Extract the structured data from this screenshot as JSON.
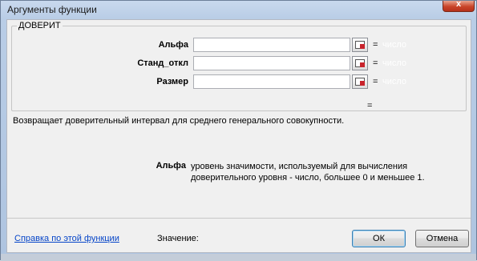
{
  "window": {
    "title": "Аргументы функции",
    "close_label": "x"
  },
  "function": {
    "name": "ДОВЕРИТ",
    "description": "Возвращает доверительный интервал для среднего генерального совокупности.",
    "result_eq": "="
  },
  "arguments": [
    {
      "label": "Альфа",
      "value": "",
      "eq": "=",
      "type_hint": "число"
    },
    {
      "label": "Станд_откл",
      "value": "",
      "eq": "=",
      "type_hint": "число"
    },
    {
      "label": "Размер",
      "value": "",
      "eq": "=",
      "type_hint": "число"
    }
  ],
  "help": {
    "arg_name": "Альфа",
    "text_line1": "уровень значимости, используемый для вычисления",
    "text_line2": "доверительного уровня - число, большее 0 и меньшее 1."
  },
  "footer": {
    "help_link": "Справка по этой функции",
    "value_label": "Значение:",
    "ok_label": "ОК",
    "cancel_label": "Отмена"
  },
  "icons": {
    "ref_button": "collapse-dialog-icon"
  }
}
